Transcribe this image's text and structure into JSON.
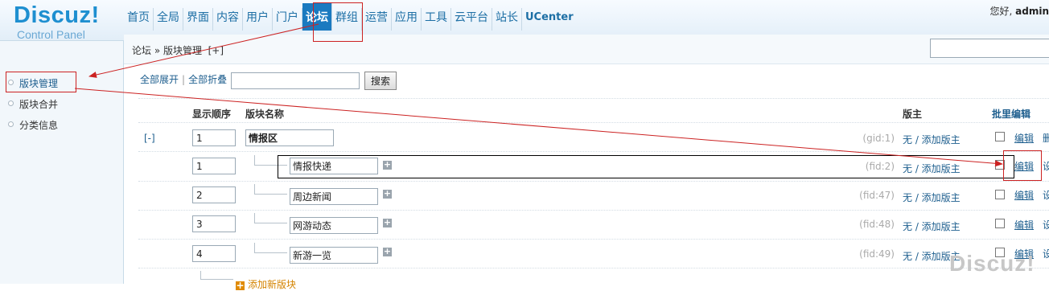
{
  "header": {
    "logo_brand": "Discuz!",
    "logo_sub": "Control Panel",
    "greeting": "您好, ",
    "user": "admin"
  },
  "nav": [
    "首页",
    "全局",
    "界面",
    "内容",
    "用户",
    "门户",
    "论坛",
    "群组",
    "运营",
    "应用",
    "工具",
    "云平台",
    "站长",
    "UCenter"
  ],
  "sidebar": {
    "items": [
      {
        "label": "版块管理"
      },
      {
        "label": "版块合并"
      },
      {
        "label": "分类信息"
      }
    ]
  },
  "breadcrumb": "论坛 » 版块管理  [+]",
  "toolbar": {
    "expand_all": "全部展开",
    "collapse_all": "全部折叠",
    "search_button": "搜索"
  },
  "table": {
    "headers": {
      "order": "显示顺序",
      "name": "版块名称",
      "moderator": "版主",
      "batch_edit": "批里编辑"
    },
    "collapse_toggle": "[-]",
    "rows": [
      {
        "order": "1",
        "name": "情报区",
        "id_label": "(gid:1)",
        "moderator": "无 / 添加版主",
        "edit": "编辑",
        "extra": "删"
      },
      {
        "order": "1",
        "name": "情报快递",
        "id_label": "(fid:2)",
        "moderator": "无 / 添加版主",
        "edit": "编辑",
        "extra": "设"
      },
      {
        "order": "2",
        "name": "周边新闻",
        "id_label": "(fid:47)",
        "moderator": "无 / 添加版主",
        "edit": "编辑",
        "extra": "设"
      },
      {
        "order": "3",
        "name": "网游动态",
        "id_label": "(fid:48)",
        "moderator": "无 / 添加版主",
        "edit": "编辑",
        "extra": "设"
      },
      {
        "order": "4",
        "name": "新游一览",
        "id_label": "(fid:49)",
        "moderator": "无 / 添加版主",
        "edit": "编辑",
        "extra": "设"
      }
    ],
    "add_forum": "添加新版块"
  },
  "watermark": "Discuz!"
}
